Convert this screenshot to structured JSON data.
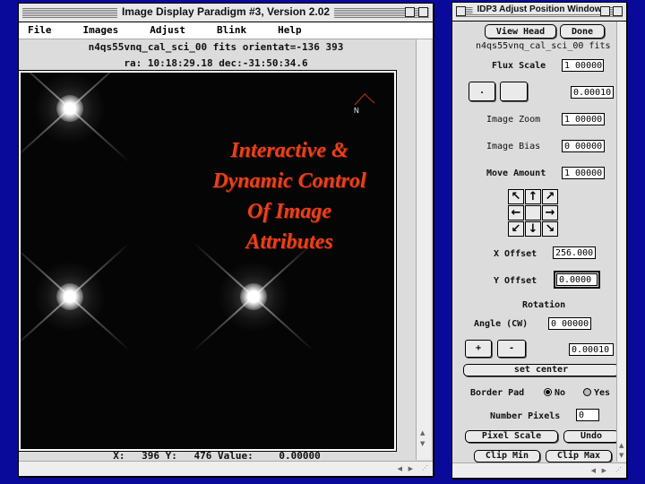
{
  "main_window": {
    "title": "Image Display Paradigm #3, Version 2.02",
    "menu": [
      "File",
      "Images",
      "Adjust",
      "Blink",
      "Help"
    ],
    "file_line": "n4qs55vnq_cal_sci_00 fits  orientat=-136 393",
    "coord_line": "ra: 10:18:29.18 dec:-31:50:34.6",
    "overlay_text": [
      "Interactive &",
      "Dynamic Control",
      "Of Image",
      "Attributes"
    ],
    "compass_label": "N",
    "status": {
      "x_label": "X:",
      "x_value": "396",
      "y_label": "Y:",
      "y_value": "476",
      "value_label": "Value:",
      "value": "0.00000"
    }
  },
  "side_window": {
    "title": "IDP3 Adjust Position Window",
    "view_head_label": "View Head",
    "done_label": "Done",
    "filename": "n4qs55vnq_cal_sci_00 fits",
    "flux_scale_label": "Flux Scale",
    "flux_scale_value": "1 00000",
    "plus_button_label": ".",
    "blank_button_label": "",
    "flux_step_value": "0.00010",
    "image_zoom_label": "Image Zoom",
    "image_zoom_value": "1 00000",
    "image_bias_label": "Image Bias",
    "image_bias_value": "0 00000",
    "move_amount_label": "Move Amount",
    "move_amount_value": "1 00000",
    "arrows": [
      "↖",
      "↑",
      "↗",
      "←",
      "",
      "→",
      "↙",
      "↓",
      "↘"
    ],
    "x_offset_label": "X Offset",
    "x_offset_value": "256.000",
    "y_offset_label": "Y Offset",
    "y_offset_value": "0.0000",
    "rotation_label": "Rotation",
    "angle_label": "Angle (CW)",
    "angle_value": "0 00000",
    "rot_plus_label": "+",
    "rot_minus_label": "-",
    "rot_step_value": "0.00010",
    "set_center_label": "set center",
    "border_pad_label": "Border Pad",
    "border_pad_no": "No",
    "border_pad_yes": "Yes",
    "border_pad_selected": "No",
    "number_pixels_label": "Number Pixels",
    "number_pixels_value": "0",
    "pixel_scale_label": "Pixel Scale",
    "undo_label": "Undo",
    "clip_min_label": "Clip Min",
    "clip_max_label": "Clip Max"
  },
  "colors": {
    "desktop": "#0a0a9a",
    "overlay_text": "#e8401c",
    "window_bg": "#dcdcdc"
  }
}
